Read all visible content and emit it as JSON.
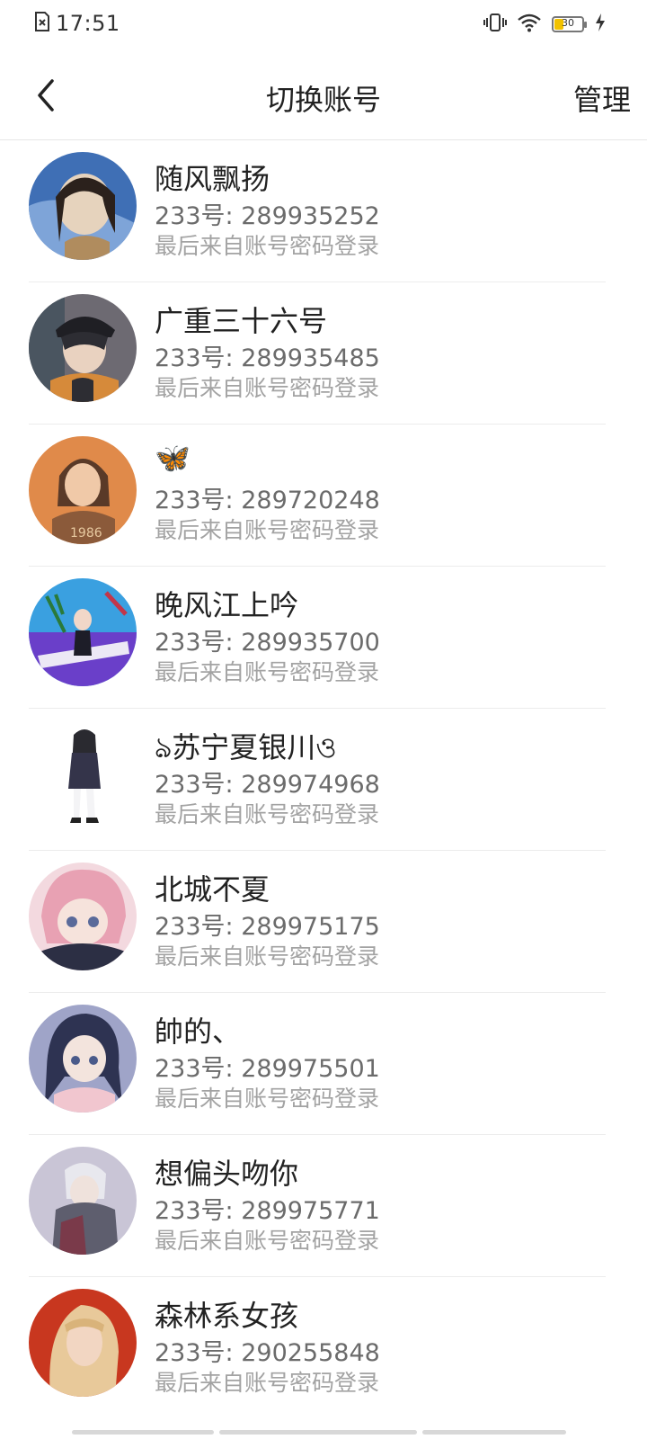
{
  "status_bar": {
    "time": "17:51",
    "battery": "30"
  },
  "header": {
    "title": "切换账号",
    "manage_label": "管理"
  },
  "accounts": [
    {
      "name": "随风飘扬",
      "id": "233号: 289935252",
      "login": "最后来自账号密码登录",
      "avatar_colors": [
        "#3f6fb5",
        "#e6d3bd"
      ]
    },
    {
      "name": "广重三十六号",
      "id": "233号: 289935485",
      "login": "最后来自账号密码登录",
      "avatar_colors": [
        "#2d2d33",
        "#d68a3a"
      ]
    },
    {
      "name": "🦋",
      "id": "233号: 289720248",
      "login": "最后来自账号密码登录",
      "avatar_colors": [
        "#e08a4a",
        "#8b5a3a"
      ]
    },
    {
      "name": "晚风江上吟",
      "id": "233号: 289935700",
      "login": "最后来自账号密码登录",
      "avatar_colors": [
        "#6a3fc9",
        "#3aa0e0"
      ]
    },
    {
      "name": "ঌ苏宁夏银川ও",
      "id": "233号: 289974968",
      "login": "最后来自账号密码登录",
      "avatar_colors": [
        "#ffffff",
        "#2f2f3a"
      ]
    },
    {
      "name": "北城不夏",
      "id": "233号: 289975175",
      "login": "最后来自账号密码登录",
      "avatar_colors": [
        "#e8a1b3",
        "#3a3f5a"
      ]
    },
    {
      "name": "帥的、",
      "id": "233号: 289975501",
      "login": "最后来自账号密码登录",
      "avatar_colors": [
        "#9fa4c8",
        "#3a3f5a"
      ]
    },
    {
      "name": "想偏头吻你",
      "id": "233号: 289975771",
      "login": "最后来自账号密码登录",
      "avatar_colors": [
        "#c9c5d6",
        "#7a3a4a"
      ]
    },
    {
      "name": "森林系女孩",
      "id": "233号: 290255848",
      "login": "最后来自账号密码登录",
      "avatar_colors": [
        "#c8371f",
        "#e8c99a"
      ]
    }
  ]
}
